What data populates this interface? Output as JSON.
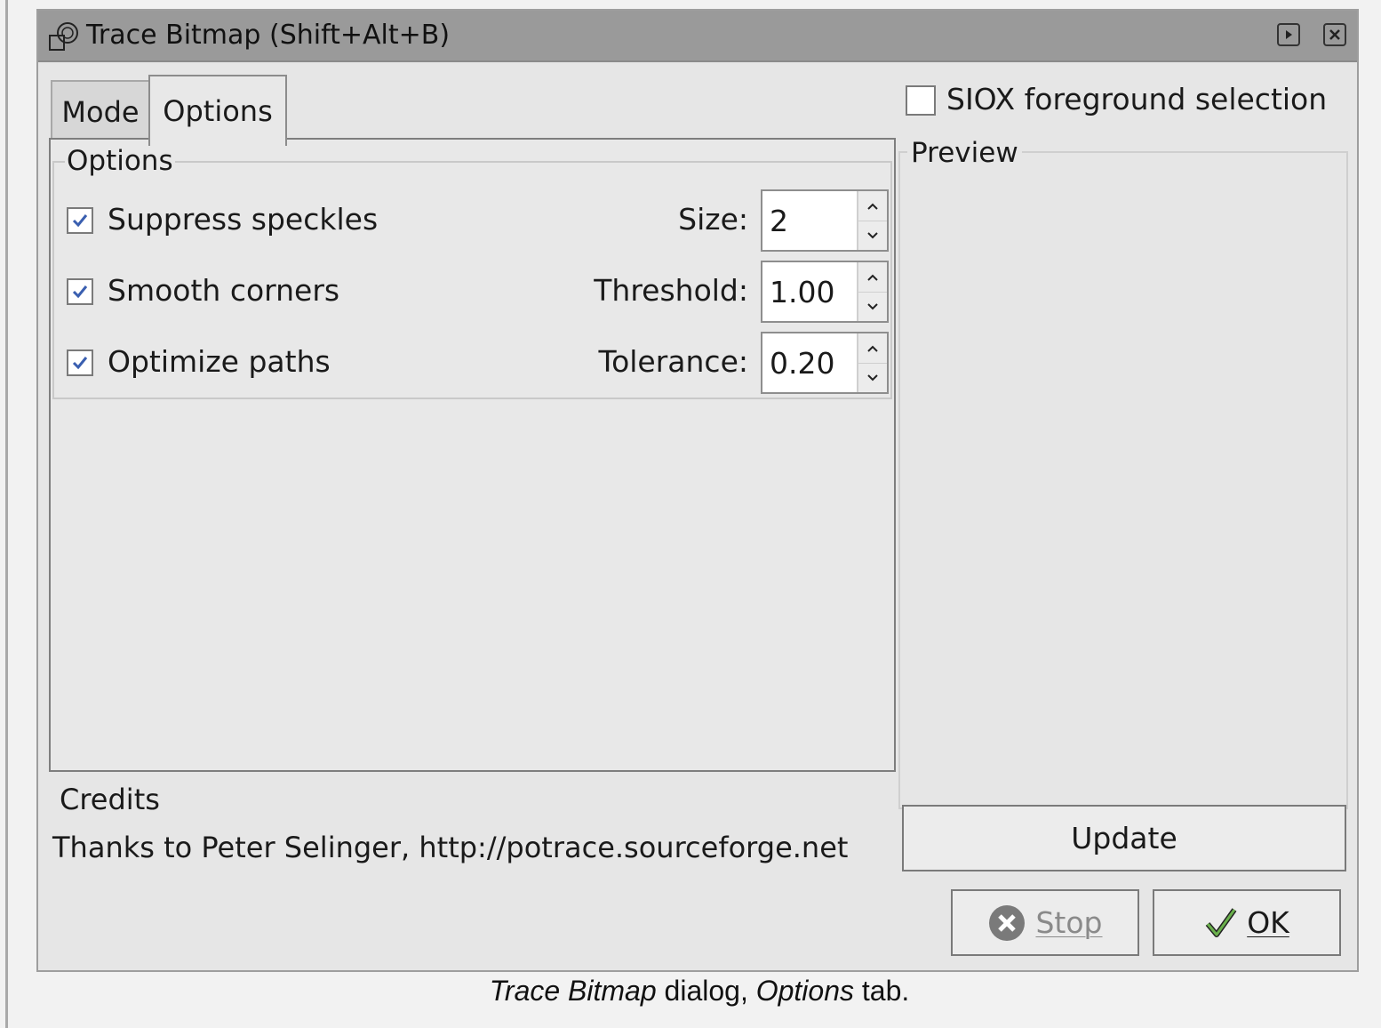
{
  "window": {
    "title": "Trace Bitmap (Shift+Alt+B)"
  },
  "tabs": [
    {
      "label": "Mode",
      "active": false
    },
    {
      "label": "Options",
      "active": true
    }
  ],
  "options_frame": {
    "legend": "Options",
    "rows": [
      {
        "label": "Suppress speckles",
        "checked": true,
        "field_label": "Size:",
        "value": "2"
      },
      {
        "label": "Smooth corners",
        "checked": true,
        "field_label": "Threshold:",
        "value": "1.00"
      },
      {
        "label": "Optimize paths",
        "checked": true,
        "field_label": "Tolerance:",
        "value": "0.20"
      }
    ]
  },
  "credits": {
    "title": "Credits",
    "text": "Thanks to Peter Selinger, http://potrace.sourceforge.net"
  },
  "siox": {
    "label": "SIOX foreground selection",
    "checked": false
  },
  "preview": {
    "legend": "Preview"
  },
  "buttons": {
    "update": "Update",
    "stop": "Stop",
    "ok": "OK"
  },
  "caption": {
    "part1": "Trace Bitmap",
    "part2": " dialog, ",
    "part3": "Options",
    "part4": " tab."
  },
  "icons": {
    "title": "trace-bitmap-icon",
    "stop": "stop-icon",
    "ok": "check-icon",
    "titlebar_buttons": [
      "shade-icon",
      "close-icon"
    ]
  },
  "colors": {
    "titlebar": "#9a9a9a",
    "window_bg": "#e6e6e6",
    "check": "#3a5fb0",
    "stop_icon": "#7a7a7a",
    "ok_check": "#4a8a2a"
  }
}
